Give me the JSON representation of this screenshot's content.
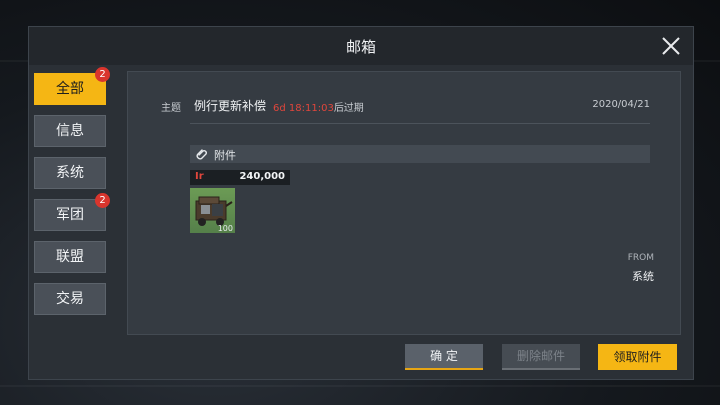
{
  "dialog": {
    "title": "邮箱"
  },
  "sidebar": {
    "items": [
      {
        "label": "全部",
        "badge": "2",
        "active": true
      },
      {
        "label": "信息",
        "badge": null,
        "active": false
      },
      {
        "label": "系统",
        "badge": null,
        "active": false
      },
      {
        "label": "军团",
        "badge": "2",
        "active": false
      },
      {
        "label": "联盟",
        "badge": null,
        "active": false
      },
      {
        "label": "交易",
        "badge": null,
        "active": false
      }
    ]
  },
  "mail": {
    "subject_label": "主题",
    "subject": "例行更新补偿",
    "expiry_timer": "6d 18:11:03",
    "expiry_suffix": "后过期",
    "date": "2020/04/21",
    "attachments_label": "附件",
    "attachment": {
      "currency_logo": "Ir",
      "amount": "240,000",
      "quantity": "100",
      "icon": "vehicle-crate-icon"
    },
    "from_label": "FROM",
    "from_value": "系统"
  },
  "buttons": {
    "confirm": "确 定",
    "delete": "删除邮件",
    "claim": "领取附件"
  },
  "colors": {
    "accent": "#f5b614",
    "badge": "#d9352d",
    "timer": "#e0463c"
  }
}
